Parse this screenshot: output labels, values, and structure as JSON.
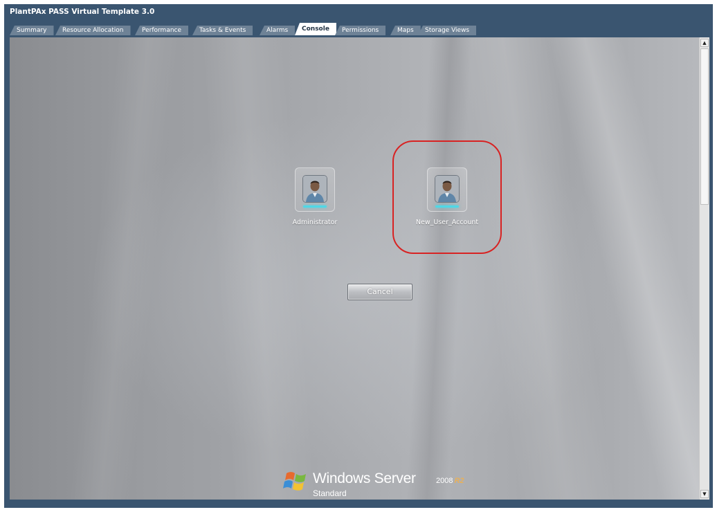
{
  "window": {
    "title": "PlantPAx PASS Virtual Template 3.0"
  },
  "tabs": [
    {
      "label": "Summary",
      "active": false
    },
    {
      "label": "Resource Allocation",
      "active": false
    },
    {
      "label": "Performance",
      "active": false
    },
    {
      "label": "Tasks & Events",
      "active": false
    },
    {
      "label": "Alarms",
      "active": false
    },
    {
      "label": "Console",
      "active": true
    },
    {
      "label": "Permissions",
      "active": false
    },
    {
      "label": "Maps",
      "active": false
    },
    {
      "label": "Storage Views",
      "active": false
    }
  ],
  "console": {
    "users": [
      {
        "name": "Administrator",
        "icon": "user-avatar-icon"
      },
      {
        "name": "New_User_Account",
        "icon": "user-avatar-icon",
        "highlighted": true
      }
    ],
    "cancel_label": "Cancel",
    "brand": {
      "name": "Windows Server",
      "version": "2008",
      "release": "R2",
      "edition": "Standard",
      "icon": "windows-flag-icon"
    }
  },
  "colors": {
    "title_bar": "#3a5570",
    "highlight": "#d82222",
    "avatar_glow": "#4fd8e6"
  }
}
